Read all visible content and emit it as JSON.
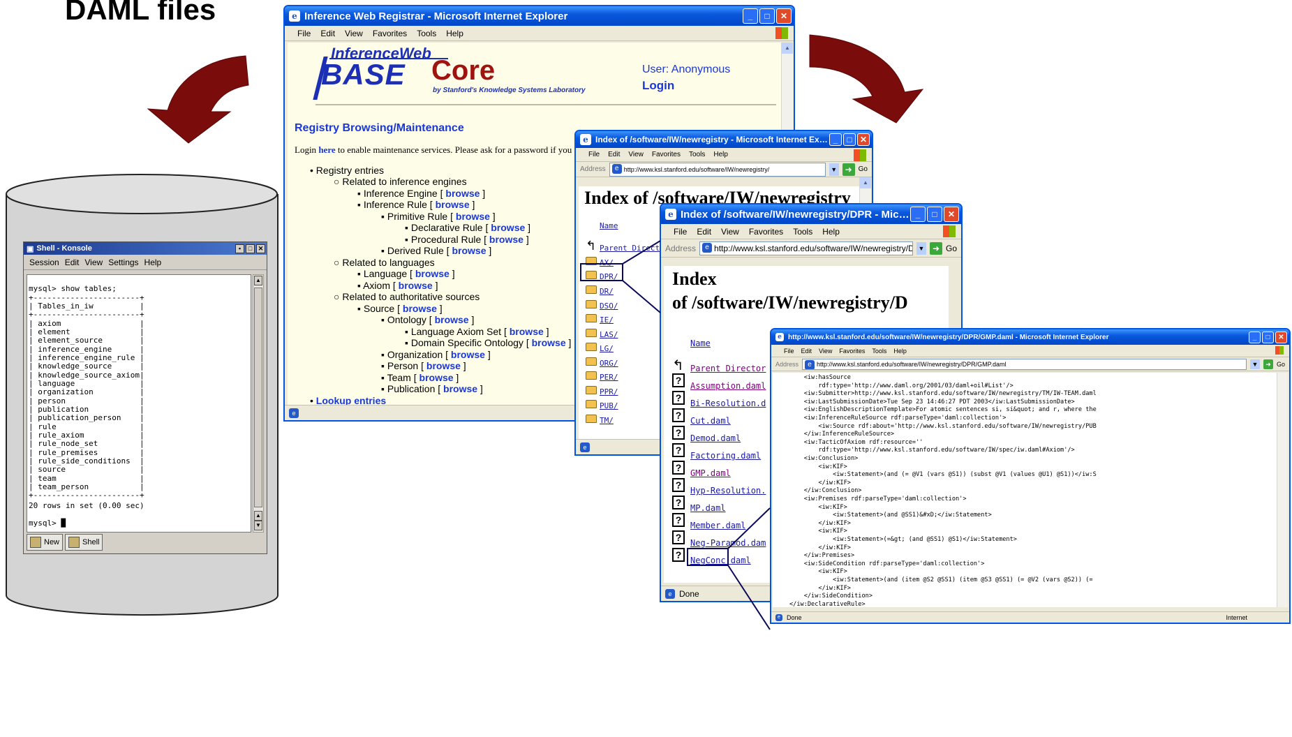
{
  "heading": "DAML files",
  "registrar": {
    "title": "Inference Web Registrar - Microsoft Internet Explorer",
    "menu": [
      "File",
      "Edit",
      "View",
      "Favorites",
      "Tools",
      "Help"
    ],
    "logo_top": "InferenceWeb",
    "logo_base": "BASE",
    "logo_core": "Core",
    "logo_by": "by Stanford's Knowledge Systems Laboratory",
    "user": "User: Anonymous",
    "login": "Login",
    "section": "Registry Browsing/Maintenance",
    "login_prefix": "Login",
    "login_here": "here",
    "login_suffix": "to enable maintenance services. Please ask for a password if you c",
    "tree": [
      {
        "label": "Registry entries",
        "browse": ""
      },
      {
        "label": "Related to inference engines",
        "browse": ""
      },
      {
        "label": "Inference Engine",
        "browse": "browse"
      },
      {
        "label": "Inference Rule",
        "browse": "browse"
      },
      {
        "label": "Primitive Rule",
        "browse": "browse"
      },
      {
        "label": "Declarative Rule",
        "browse": "browse"
      },
      {
        "label": "Procedural Rule",
        "browse": "browse"
      },
      {
        "label": "Derived Rule",
        "browse": "browse"
      },
      {
        "label": "Related to languages",
        "browse": ""
      },
      {
        "label": "Language",
        "browse": "browse"
      },
      {
        "label": "Axiom",
        "browse": "browse"
      },
      {
        "label": "Related to authoritative sources",
        "browse": ""
      },
      {
        "label": "Source",
        "browse": "browse"
      },
      {
        "label": "Ontology",
        "browse": "browse"
      },
      {
        "label": "Language Axiom Set",
        "browse": "browse"
      },
      {
        "label": "Domain Specific Ontology",
        "browse": "browse"
      },
      {
        "label": "Organization",
        "browse": "browse"
      },
      {
        "label": "Person",
        "browse": "browse"
      },
      {
        "label": "Team",
        "browse": "browse"
      },
      {
        "label": "Publication",
        "browse": "browse"
      }
    ],
    "lookup": "Lookup entries"
  },
  "index1": {
    "title": "Index of /software/IW/newregistry - Microsoft Internet Explorer",
    "menu": [
      "File",
      "Edit",
      "View",
      "Favorites",
      "Tools",
      "Help"
    ],
    "address_label": "Address",
    "url": "http://www.ksl.stanford.edu/software/IW/newregistry/",
    "go": "Go",
    "heading": "Index of /software/IW/newregistry",
    "name_col": "Name",
    "parent": "Parent Directo",
    "entries": [
      "AX/",
      "DPR/",
      "DR/",
      "DSO/",
      "IE/",
      "LAS/",
      "LG/",
      "ORG/",
      "PER/",
      "PPR/",
      "PUB/",
      "TM/"
    ]
  },
  "index2": {
    "title": "Index of /software/IW/newregistry/DPR - Microsoft Int...",
    "menu": [
      "File",
      "Edit",
      "View",
      "Favorites",
      "Tools",
      "Help"
    ],
    "address_label": "Address",
    "url": "http://www.ksl.stanford.edu/software/IW/newregistry/DPR/",
    "go": "Go",
    "heading1": "Index",
    "heading2": "of /software/IW/newregistry/D",
    "name_col": "Name",
    "parent": "Parent Director",
    "entries": [
      "Assumption.daml",
      "Bi-Resolution.d",
      "Cut.daml",
      "Demod.daml",
      "Factoring.daml",
      "GMP.daml",
      "Hyp-Resolution.",
      "MP.daml",
      "Member.daml",
      "Neg-Paramod.dam",
      "NegConc.daml"
    ],
    "status": "Done"
  },
  "gmp": {
    "title": "http://www.ksl.stanford.edu/software/IW/newregistry/DPR/GMP.daml - Microsoft Internet Explorer",
    "menu": [
      "File",
      "Edit",
      "View",
      "Favorites",
      "Tools",
      "Help"
    ],
    "address_label": "Address",
    "url": "http://www.ksl.stanford.edu/software/IW/newregistry/DPR/GMP.daml",
    "go": "Go",
    "lines": [
      "    <iw:hasSource",
      "        rdf:type='http://www.daml.org/2001/03/daml+oil#List'/>",
      "    <iw:Submitter>http://www.ksl.stanford.edu/software/IW/newregistry/TM/IW-TEAM.daml",
      "    <iw:LastSubmissionDate>Tue Sep 23 14:46:27 PDT 2003</iw:LastSubmissionDate>",
      "    <iw:EnglishDescriptionTemplate>For atomic sentences si, si&quot; and r, where the",
      "    <iw:InferenceRuleSource rdf:parseType='daml:collection'>",
      "        <iw:Source rdf:about='http://www.ksl.stanford.edu/software/IW/newregistry/PUB",
      "    </iw:InferenceRuleSource>",
      "    <iw:TacticOfAxiom rdf:resource=''",
      "        rdf:type='http://www.ksl.stanford.edu/software/IW/spec/iw.daml#Axiom'/>",
      "    <iw:Conclusion>",
      "        <iw:KIF>",
      "            <iw:Statement>(and (= @V1 (vars @S1)) (subst @V1 (values @U1) @S1))</iw:S",
      "        </iw:KIF>",
      "    </iw:Conclusion>",
      "    <iw:Premises rdf:parseType='daml:collection'>",
      "        <iw:KIF>",
      "            <iw:Statement>(and @SS1)&#xD;</iw:Statement>",
      "        </iw:KIF>",
      "        <iw:KIF>",
      "            <iw:Statement>(=&gt; (and @SS1) @S1)</iw:Statement>",
      "        </iw:KIF>",
      "    </iw:Premises>",
      "    <iw:SideCondition rdf:parseType='daml:collection'>",
      "        <iw:KIF>",
      "            <iw:Statement>(and (item @S2 @SS1) (item @S3 @SS1) (= @V2 (vars @S2)) (=",
      "        </iw:KIF>",
      "    </iw:SideCondition>",
      "</iw:DeclarativeRule>"
    ],
    "status": "Done",
    "zone": "Internet"
  },
  "konsole": {
    "title": "Shell - Konsole",
    "menu": [
      "Session",
      "Edit",
      "View",
      "Settings",
      "Help"
    ],
    "lines": [
      "",
      "mysql> show tables;",
      "+-----------------------+",
      "| Tables_in_iw          |",
      "+-----------------------+",
      "| axiom                 |",
      "| element               |",
      "| element_source        |",
      "| inference_engine      |",
      "| inference_engine_rule |",
      "| knowledge_source      |",
      "| knowledge_source_axiom|",
      "| language              |",
      "| organization          |",
      "| person                |",
      "| publication           |",
      "| publication_person    |",
      "| rule                  |",
      "| rule_axiom            |",
      "| rule_node_set         |",
      "| rule_premises         |",
      "| rule_side_conditions  |",
      "| source                |",
      "| team                  |",
      "| team_person           |",
      "+-----------------------+",
      "20 rows in set (0.00 sec)",
      "",
      "mysql> █"
    ],
    "tabs": [
      "New",
      "Shell"
    ]
  },
  "colors": {
    "arrow": "#7a0c0c",
    "xp_title": "#0a58dc",
    "link": "#1a37d8"
  }
}
